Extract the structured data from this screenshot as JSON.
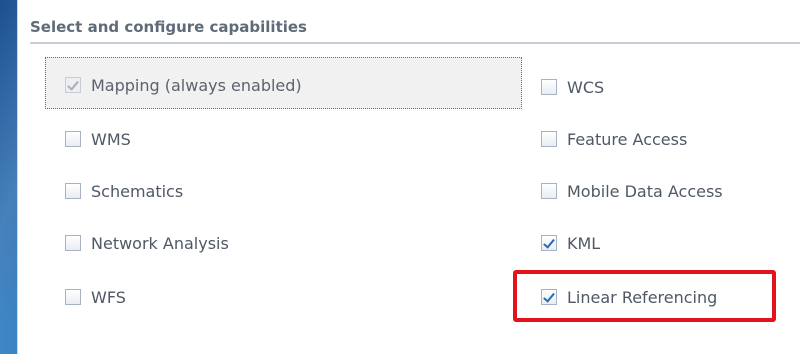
{
  "section": {
    "title": "Select and configure capabilities"
  },
  "capabilities": {
    "left": [
      {
        "label": "Mapping (always enabled)",
        "checked": true,
        "disabled": true
      },
      {
        "label": "WMS",
        "checked": false
      },
      {
        "label": "Schematics",
        "checked": false
      },
      {
        "label": "Network Analysis",
        "checked": false
      },
      {
        "label": "WFS",
        "checked": false
      }
    ],
    "right": [
      {
        "label": "WCS",
        "checked": false
      },
      {
        "label": "Feature Access",
        "checked": false
      },
      {
        "label": "Mobile Data Access",
        "checked": false
      },
      {
        "label": "KML",
        "checked": true
      },
      {
        "label": "Linear Referencing",
        "checked": true
      }
    ]
  },
  "colors": {
    "highlight": "#e3121b",
    "check": "#2a6ab5"
  }
}
